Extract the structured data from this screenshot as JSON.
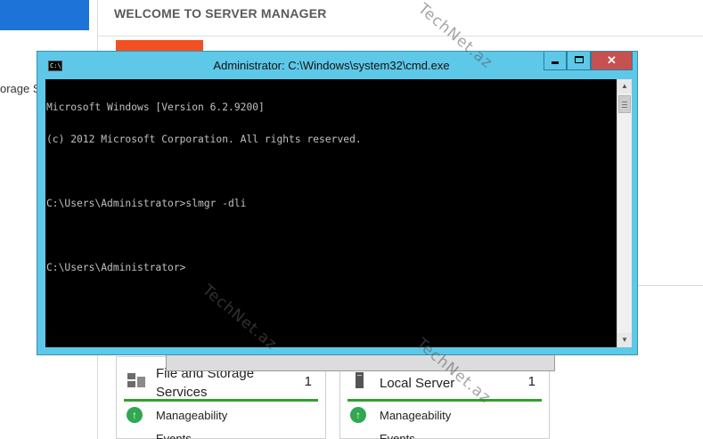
{
  "server_manager": {
    "left_item_label": "orage Se",
    "welcome_title": "WELCOME TO SERVER MANAGER",
    "tiles": [
      {
        "title": "File and Storage Services",
        "count": "1",
        "status": "Manageability",
        "events": "Events",
        "icon": "file-storage-icon"
      },
      {
        "title": "Local Server",
        "count": "1",
        "status": "Manageability",
        "events": "Events",
        "icon": "server-icon"
      }
    ],
    "colors": {
      "accent_orange": "#f25022",
      "selected_blue": "#1e73d8",
      "status_green": "#33a02c"
    }
  },
  "cmd": {
    "title": "Administrator: C:\\Windows\\system32\\cmd.exe",
    "icon_text": "C:\\",
    "lines": [
      "Microsoft Windows [Version 6.2.9200]",
      "(c) 2012 Microsoft Corporation. All rights reserved.",
      "",
      "C:\\Users\\Administrator>slmgr -dli",
      "",
      "C:\\Users\\Administrator>"
    ],
    "close_label": "✕",
    "colors": {
      "frame": "#5ec8e8",
      "close": "#c75050",
      "console_bg": "#000000",
      "console_text": "#c0c0c0"
    }
  },
  "watermark": "TechNet.az"
}
